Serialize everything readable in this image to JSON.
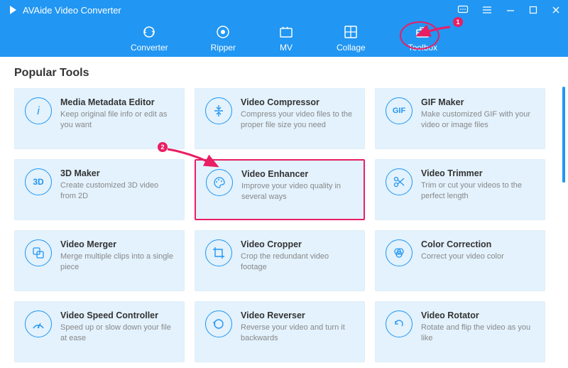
{
  "app": {
    "title": "AVAide Video Converter"
  },
  "nav": {
    "converter": "Converter",
    "ripper": "Ripper",
    "mv": "MV",
    "collage": "Collage",
    "toolbox": "Toolbox"
  },
  "section_title": "Popular Tools",
  "tools": [
    {
      "title": "Media Metadata Editor",
      "desc": "Keep original file info or edit as you want"
    },
    {
      "title": "Video Compressor",
      "desc": "Compress your video files to the proper file size you need"
    },
    {
      "title": "GIF Maker",
      "desc": "Make customized GIF with your video or image files"
    },
    {
      "title": "3D Maker",
      "desc": "Create customized 3D video from 2D"
    },
    {
      "title": "Video Enhancer",
      "desc": "Improve your video quality in several ways"
    },
    {
      "title": "Video Trimmer",
      "desc": "Trim or cut your videos to the perfect length"
    },
    {
      "title": "Video Merger",
      "desc": "Merge multiple clips into a single piece"
    },
    {
      "title": "Video Cropper",
      "desc": "Crop the redundant video footage"
    },
    {
      "title": "Color Correction",
      "desc": "Correct your video color"
    },
    {
      "title": "Video Speed Controller",
      "desc": "Speed up or slow down your file at ease"
    },
    {
      "title": "Video Reverser",
      "desc": "Reverse your video and turn it backwards"
    },
    {
      "title": "Video Rotator",
      "desc": "Rotate and flip the video as you like"
    }
  ],
  "annotations": {
    "one": "1",
    "two": "2"
  }
}
